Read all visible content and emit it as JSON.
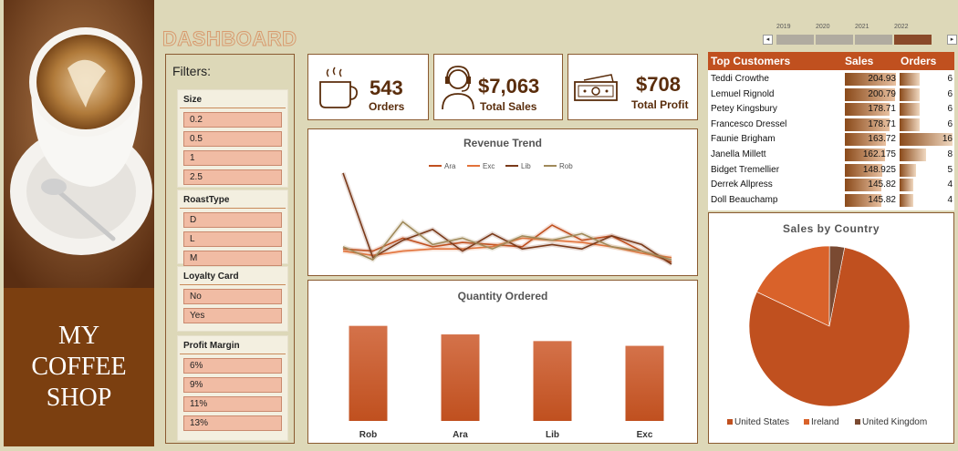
{
  "brand": {
    "line1": "MY",
    "line2": "COFFEE",
    "line3": "SHOP"
  },
  "title": "DASHBOARD",
  "timeline": {
    "years": [
      "2019",
      "2020",
      "2021",
      "2022"
    ],
    "selected": "2022"
  },
  "filters": {
    "title": "Filters:",
    "size": {
      "label": "Size",
      "options": [
        "0.2",
        "0.5",
        "1",
        "2.5"
      ]
    },
    "roast": {
      "label": "RoastType",
      "options": [
        "D",
        "L",
        "M"
      ]
    },
    "loyalty": {
      "label": "Loyalty Card",
      "options": [
        "No",
        "Yes"
      ]
    },
    "margin": {
      "label": "Profit Margin",
      "options": [
        "6%",
        "9%",
        "11%",
        "13%"
      ]
    }
  },
  "kpis": {
    "orders": {
      "value": "543",
      "label": "Orders",
      "icon": "coffee-cup-icon"
    },
    "sales": {
      "value": "$7,063",
      "label": "Total Sales",
      "icon": "customer-headset-icon"
    },
    "profit": {
      "value": "$708",
      "label": "Total Profit",
      "icon": "money-bill-icon"
    }
  },
  "colors": {
    "accent": "#c0501f",
    "dark": "#5a2d0c",
    "brand_bg": "#7b3f10",
    "page_bg": "#ddd8b8"
  },
  "customers": {
    "headers": {
      "name": "Top Customers",
      "sales": "Sales",
      "orders": "Orders"
    },
    "rows": [
      {
        "name": "Teddi Crowthe",
        "sales": "204.93",
        "orders": "6"
      },
      {
        "name": "Lemuel Rignold",
        "sales": "200.79",
        "orders": "6"
      },
      {
        "name": "Petey Kingsbury",
        "sales": "178.71",
        "orders": "6"
      },
      {
        "name": "Francesco Dressel",
        "sales": "178.71",
        "orders": "6"
      },
      {
        "name": "Faunie Brigham",
        "sales": "163.72",
        "orders": "16"
      },
      {
        "name": "Janella Millett",
        "sales": "162.175",
        "orders": "8"
      },
      {
        "name": "Bidget Tremellier",
        "sales": "148.925",
        "orders": "5"
      },
      {
        "name": "Derrek Allpress",
        "sales": "145.82",
        "orders": "4"
      },
      {
        "name": "Doll Beauchamp",
        "sales": "145.82",
        "orders": "4"
      }
    ]
  },
  "chart_data": [
    {
      "type": "line",
      "title": "Revenue Trend",
      "x": [
        1,
        2,
        3,
        4,
        5,
        6,
        7,
        8,
        9,
        10,
        11,
        12
      ],
      "ylim": [
        0,
        100
      ],
      "legend_position": "top",
      "series": [
        {
          "name": "Ara",
          "color": "#c0501f",
          "values": [
            20,
            18,
            30,
            22,
            26,
            24,
            22,
            42,
            28,
            32,
            18,
            8
          ]
        },
        {
          "name": "Exc",
          "color": "#e2723a",
          "values": [
            18,
            14,
            18,
            20,
            20,
            22,
            30,
            28,
            26,
            22,
            16,
            12
          ]
        },
        {
          "name": "Lib",
          "color": "#7a3a1a",
          "values": [
            90,
            12,
            28,
            38,
            18,
            34,
            20,
            24,
            20,
            32,
            24,
            6
          ]
        },
        {
          "name": "Rob",
          "color": "#a08a5a",
          "values": [
            22,
            10,
            45,
            24,
            30,
            20,
            32,
            28,
            34,
            22,
            18,
            10
          ]
        }
      ]
    },
    {
      "type": "bar",
      "title": "Quantity Ordered",
      "categories": [
        "Rob",
        "Ara",
        "Lib",
        "Exc"
      ],
      "values": [
        100,
        91,
        84,
        79
      ],
      "ylim": [
        0,
        115
      ]
    },
    {
      "type": "pie",
      "title": "Sales by Country",
      "legend_position": "bottom",
      "labels": [
        "United States",
        "Ireland",
        "United Kingdom"
      ],
      "values": [
        79,
        18,
        3
      ],
      "colors": [
        "#c0501f",
        "#d9622a",
        "#7a4a32"
      ]
    }
  ]
}
